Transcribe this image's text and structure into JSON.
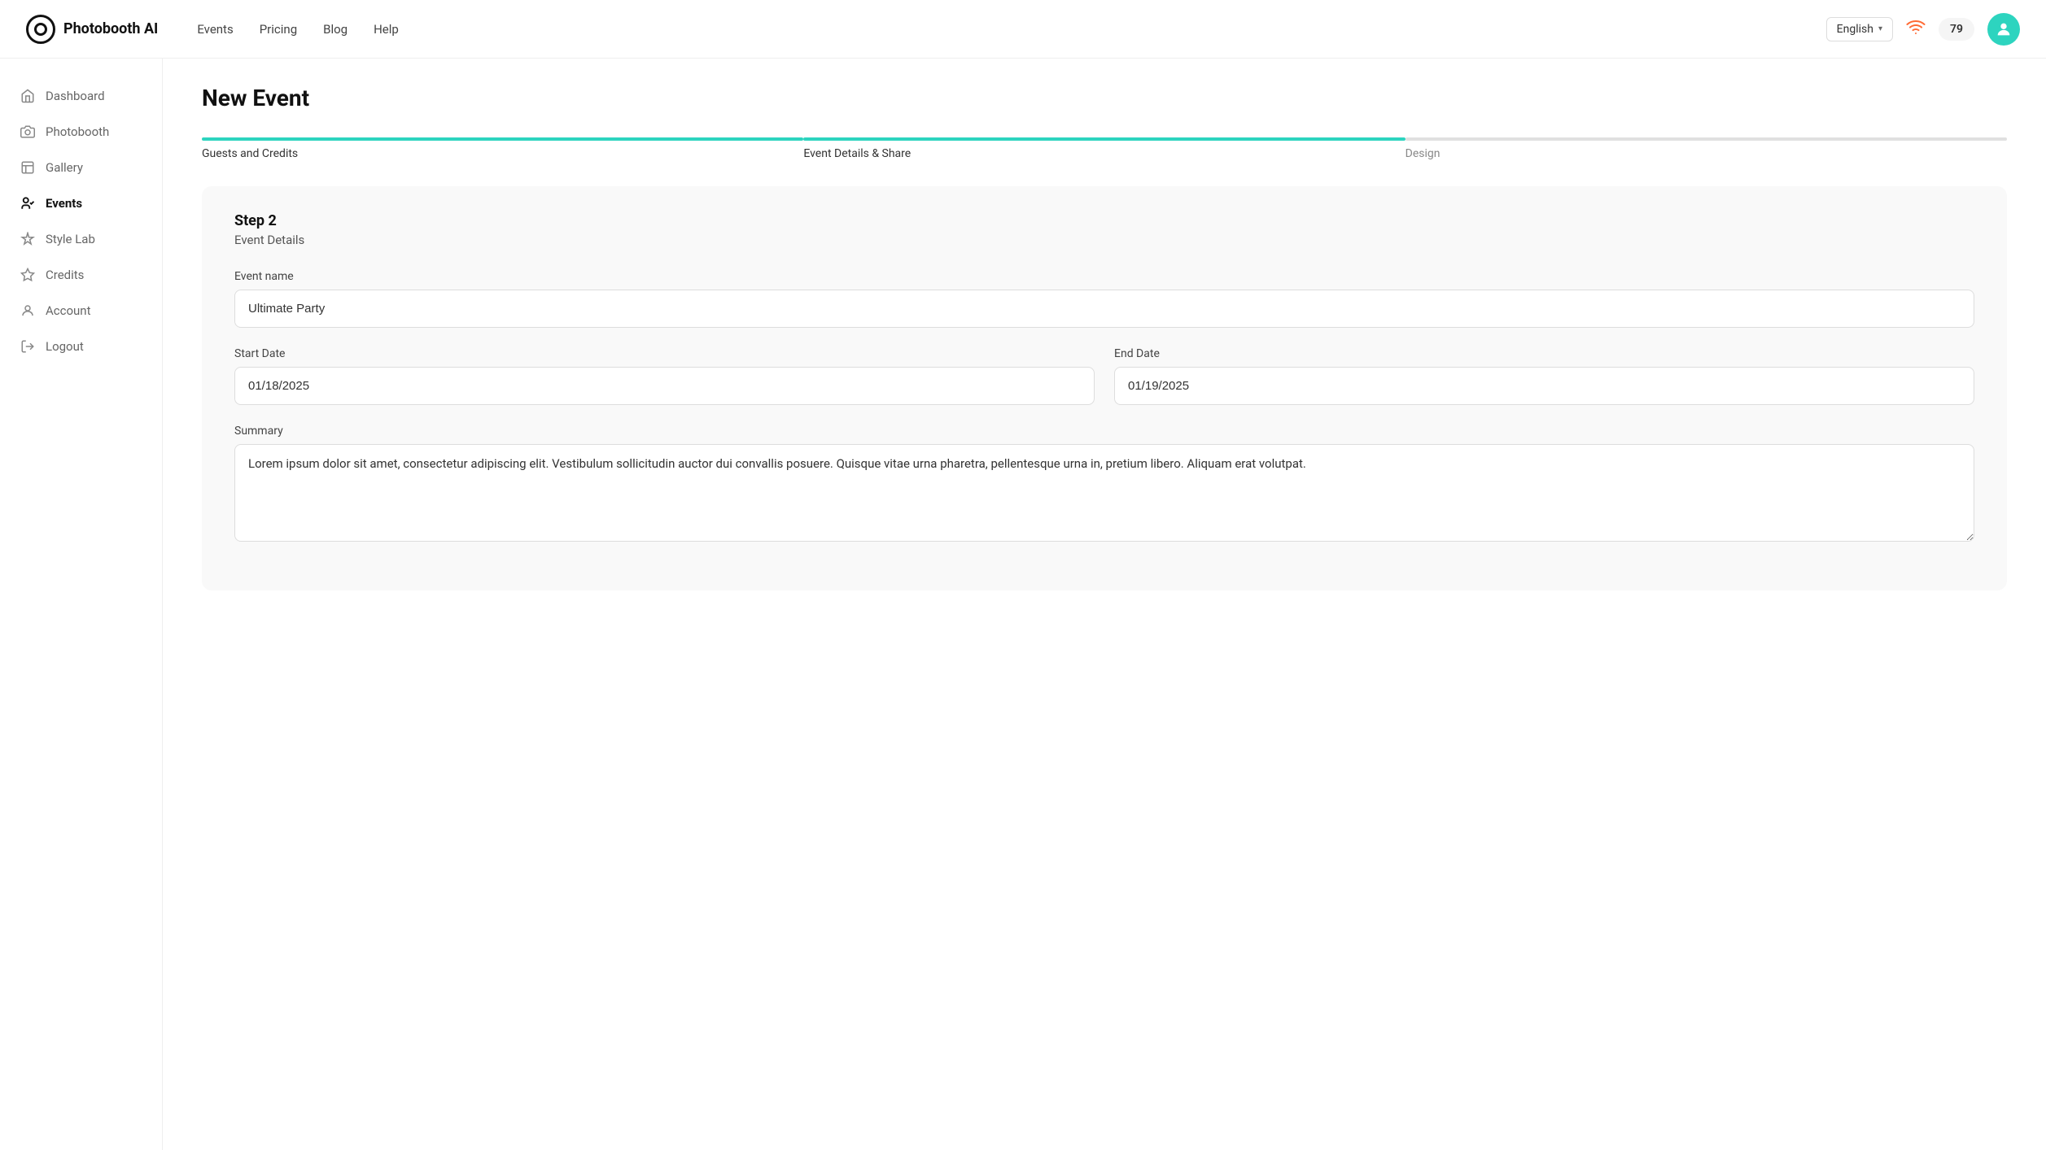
{
  "header": {
    "logo_text": "Photobooth AI",
    "nav_items": [
      {
        "label": "Events",
        "href": "#"
      },
      {
        "label": "Pricing",
        "href": "#"
      },
      {
        "label": "Blog",
        "href": "#"
      },
      {
        "label": "Help",
        "href": "#"
      }
    ],
    "language": "English",
    "credits": "79"
  },
  "sidebar": {
    "items": [
      {
        "label": "Dashboard",
        "icon": "home-icon",
        "active": false
      },
      {
        "label": "Photobooth",
        "icon": "camera-icon",
        "active": false
      },
      {
        "label": "Gallery",
        "icon": "gallery-icon",
        "active": false
      },
      {
        "label": "Events",
        "icon": "events-icon",
        "active": true
      },
      {
        "label": "Style Lab",
        "icon": "stylelab-icon",
        "active": false
      },
      {
        "label": "Credits",
        "icon": "credits-icon",
        "active": false
      },
      {
        "label": "Account",
        "icon": "account-icon",
        "active": false
      },
      {
        "label": "Logout",
        "icon": "logout-icon",
        "active": false
      }
    ]
  },
  "page": {
    "title": "New Event"
  },
  "steps": [
    {
      "label": "Guests and Credits",
      "state": "complete"
    },
    {
      "label": "Event Details & Share",
      "state": "active"
    },
    {
      "label": "Design",
      "state": "inactive"
    }
  ],
  "form": {
    "step_label": "Step 2",
    "step_sublabel": "Event Details",
    "event_name_label": "Event name",
    "event_name_value": "Ultimate Party",
    "event_name_placeholder": "Event name",
    "start_date_label": "Start Date",
    "start_date_value": "01/18/2025",
    "end_date_label": "End Date",
    "end_date_value": "01/19/2025",
    "summary_label": "Summary",
    "summary_value": "Lorem ipsum dolor sit amet, consectetur adipiscing elit. Vestibulum sollicitudin auctor dui convallis posuere. Quisque vitae urna pharetra, pellentesque urna in, pretium libero. Aliquam erat volutpat."
  }
}
